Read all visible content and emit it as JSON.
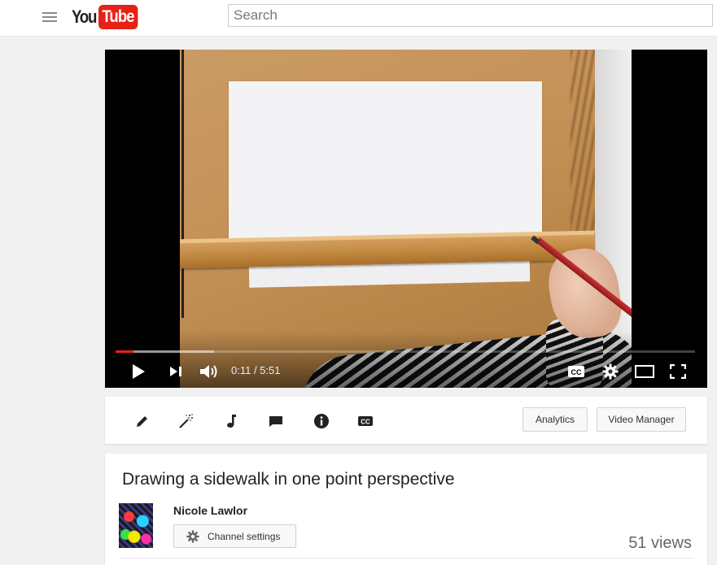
{
  "masthead": {
    "menu_icon": "hamburger-menu-icon",
    "logo_you": "You",
    "logo_tube": "Tube",
    "search_placeholder": "Search",
    "brand_color": "#e62117"
  },
  "player": {
    "time_display": "0:11 / 5:51",
    "progress_fraction": 0.031,
    "loaded_fraction": 0.17,
    "controls": [
      "play-icon",
      "next-icon",
      "volume-icon",
      "captions-icon",
      "settings-gear-icon",
      "theater-mode-icon",
      "fullscreen-icon"
    ]
  },
  "toolbar": {
    "tools": [
      "edit-pencil-icon",
      "enhancements-wand-icon",
      "audio-note-icon",
      "annotations-speech-icon",
      "info-icon",
      "subtitles-cc-icon"
    ],
    "analytics_label": "Analytics",
    "video_manager_label": "Video Manager"
  },
  "video_info": {
    "title": "Drawing a sidewalk in one point perspective",
    "channel_name": "Nicole Lawlor",
    "channel_settings_label": "Channel settings",
    "views": "51 views"
  }
}
